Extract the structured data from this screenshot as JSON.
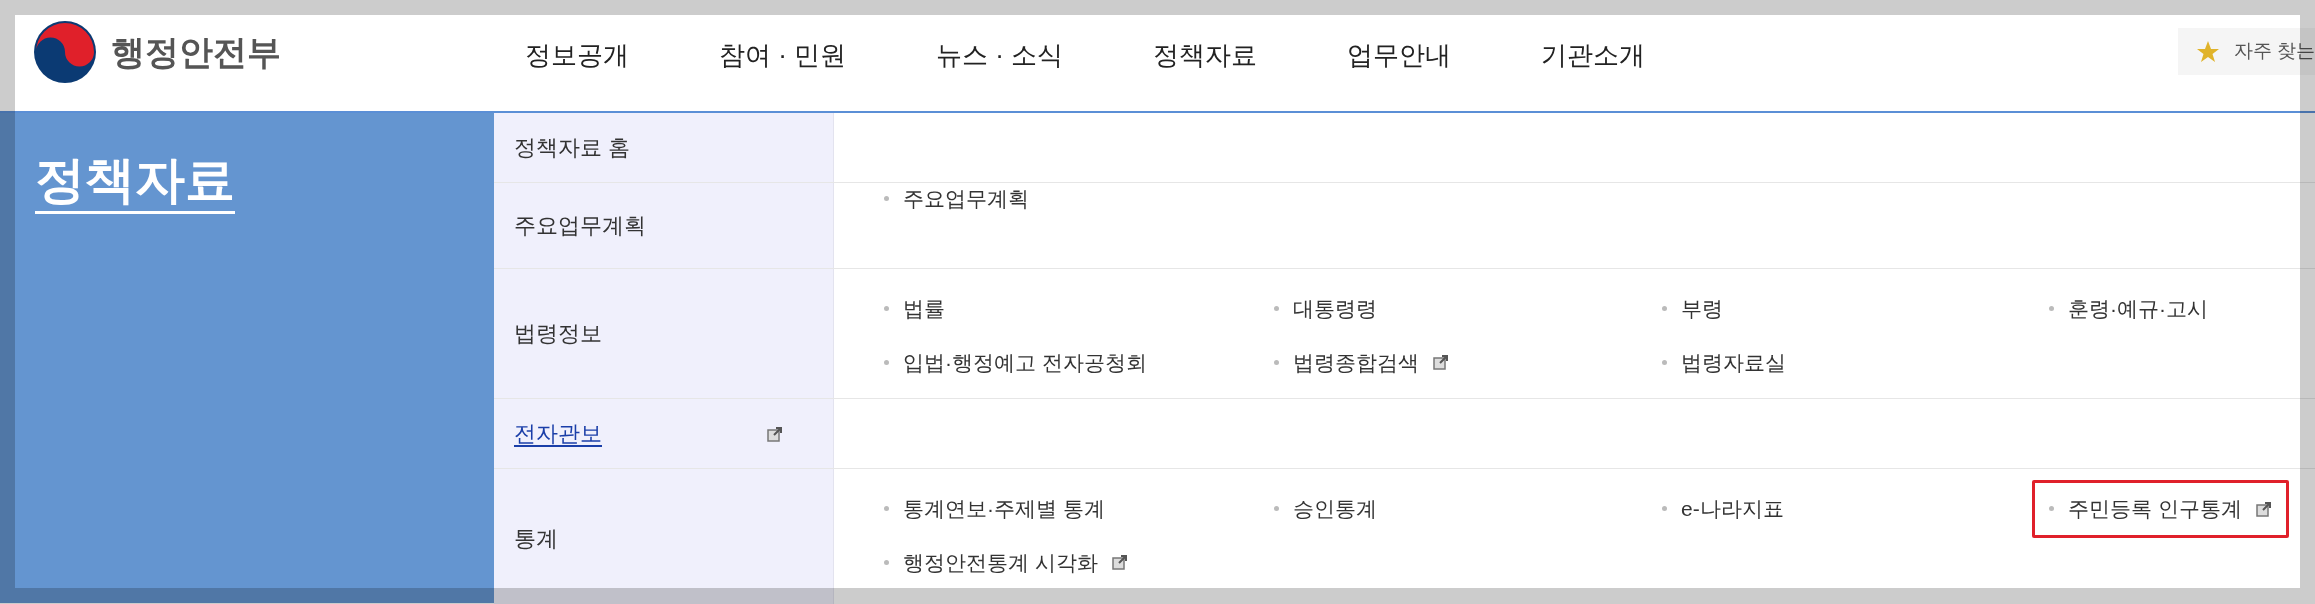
{
  "logo": {
    "title": "행정안전부"
  },
  "nav": [
    {
      "label": "정보공개"
    },
    {
      "label": "참여 · 민원"
    },
    {
      "label": "뉴스 · 소식"
    },
    {
      "label": "정책자료"
    },
    {
      "label": "업무안내"
    },
    {
      "label": "기관소개"
    }
  ],
  "favorites": {
    "label": "자주 찾는"
  },
  "section_title": "정책자료",
  "menu": [
    {
      "label": "정책자료 홈",
      "link": false,
      "external": false
    },
    {
      "label": "주요업무계획",
      "link": false,
      "external": false,
      "items": [
        {
          "label": "주요업무계획",
          "external": false,
          "highlighted": false
        }
      ]
    },
    {
      "label": "법령정보",
      "link": false,
      "external": false,
      "items": [
        {
          "label": "법률",
          "external": false,
          "highlighted": false
        },
        {
          "label": "대통령령",
          "external": false,
          "highlighted": false
        },
        {
          "label": "부령",
          "external": false,
          "highlighted": false
        },
        {
          "label": "훈령·예규·고시",
          "external": false,
          "highlighted": false
        },
        {
          "label": "입법·행정예고 전자공청회",
          "external": false,
          "highlighted": false
        },
        {
          "label": "법령종합검색",
          "external": true,
          "highlighted": false
        },
        {
          "label": "법령자료실",
          "external": false,
          "highlighted": false
        }
      ]
    },
    {
      "label": "전자관보",
      "link": true,
      "external": true
    },
    {
      "label": "통계",
      "link": false,
      "external": false,
      "items": [
        {
          "label": "통계연보·주제별 통계",
          "external": false,
          "highlighted": false
        },
        {
          "label": "승인통계",
          "external": false,
          "highlighted": false
        },
        {
          "label": "e-나라지표",
          "external": false,
          "highlighted": false
        },
        {
          "label": "주민등록 인구통계",
          "external": true,
          "highlighted": true
        },
        {
          "label": "행정안전통계 시각화",
          "external": true,
          "highlighted": false
        }
      ]
    }
  ]
}
